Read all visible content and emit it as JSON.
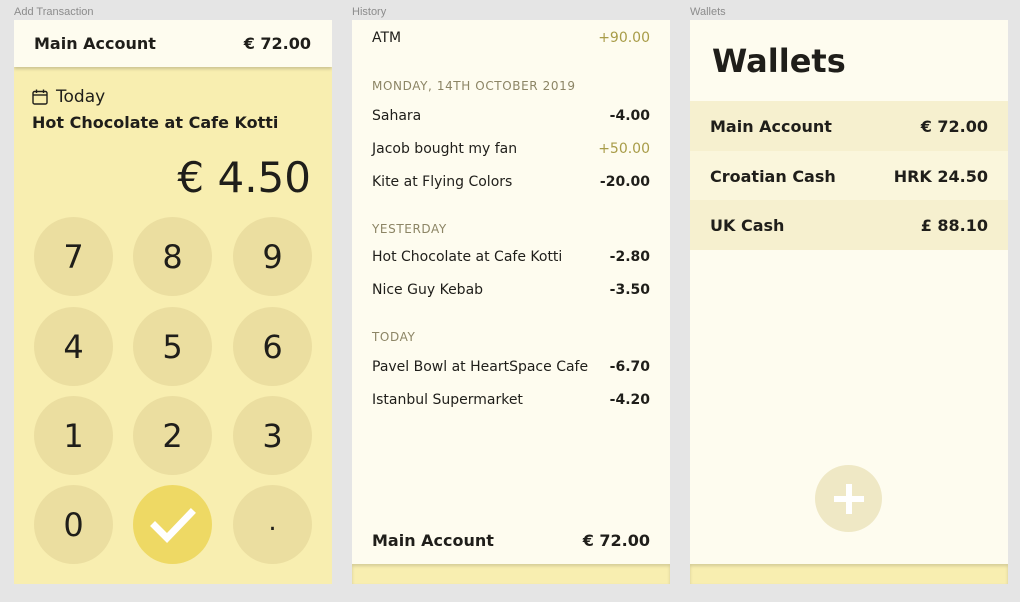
{
  "frames": {
    "add_label": "Add Transaction",
    "history_label": "History",
    "wallets_label": "Wallets"
  },
  "add": {
    "account_name": "Main Account",
    "account_balance": "€ 72.00",
    "date": "Today",
    "description": "Hot Chocolate at Cafe Kotti",
    "amount": "€ 4.50",
    "keys": [
      "7",
      "8",
      "9",
      "4",
      "5",
      "6",
      "1",
      "2",
      "3",
      "0",
      "✔",
      "."
    ],
    "confirm_icon": "check-icon",
    "date_icon": "calendar-icon"
  },
  "history": {
    "top_row": {
      "label": "ATM",
      "amount": "+90.00"
    },
    "groups": [
      {
        "heading": "MONDAY, 14TH OCTOBER 2019",
        "items": [
          {
            "label": "Sahara",
            "amount": "-4.00"
          },
          {
            "label": "Jacob bought my fan",
            "amount": "+50.00"
          },
          {
            "label": "Kite at Flying Colors",
            "amount": "-20.00"
          }
        ]
      },
      {
        "heading": "YESTERDAY",
        "items": [
          {
            "label": "Hot Chocolate at Cafe Kotti",
            "amount": "-2.80"
          },
          {
            "label": "Nice Guy Kebab",
            "amount": "-3.50"
          }
        ]
      },
      {
        "heading": "TODAY",
        "items": [
          {
            "label": "Pavel Bowl at HeartSpace Cafe",
            "amount": "-6.70"
          },
          {
            "label": "Istanbul Supermarket",
            "amount": "-4.20"
          }
        ]
      }
    ],
    "footer": {
      "account_name": "Main Account",
      "balance": "€ 72.00"
    }
  },
  "wallets": {
    "title": "Wallets",
    "items": [
      {
        "name": "Main Account",
        "balance": "€ 72.00"
      },
      {
        "name": "Croatian Cash",
        "balance": "HRK 24.50"
      },
      {
        "name": "UK Cash",
        "balance": "£ 88.10"
      }
    ],
    "add_icon": "plus-icon"
  },
  "colors": {
    "accent_yellow": "#f8eeb0",
    "key_bg": "#ebdea0",
    "confirm_bg": "#eed964",
    "card_bg": "#fefcef",
    "positive_amount": "#a89c48"
  }
}
